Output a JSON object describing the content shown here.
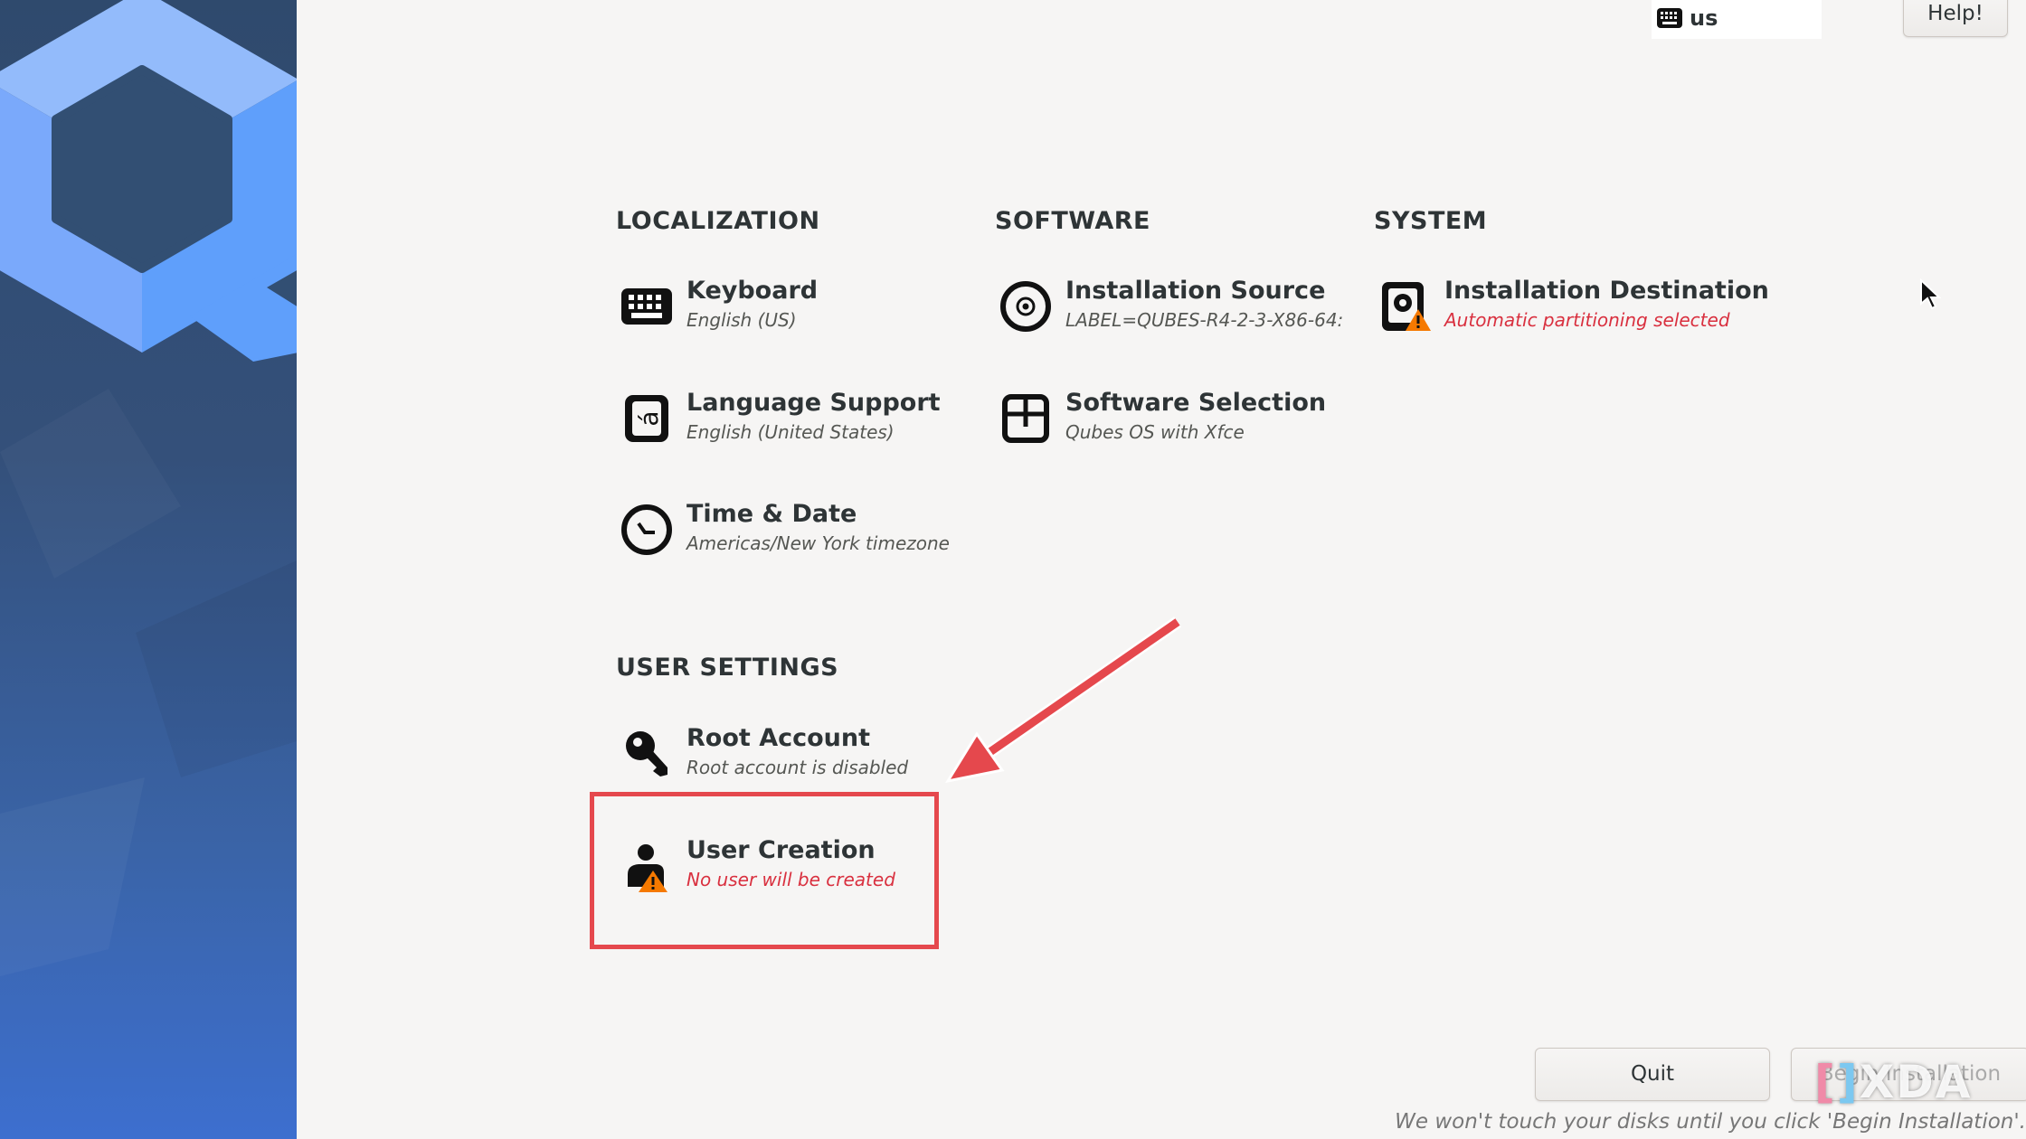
{
  "colors": {
    "accent_warning": "#d9303f",
    "annotation": "#e5484d",
    "sidebar_blue": "#3d6fcf"
  },
  "topbar": {
    "keyboard_layout": "us",
    "keyboard_icon": "keyboard-icon",
    "help_label": "Help!"
  },
  "sections": {
    "localization": "LOCALIZATION",
    "software": "SOFTWARE",
    "system": "SYSTEM",
    "user_settings": "USER SETTINGS"
  },
  "spokes": {
    "keyboard": {
      "title": "Keyboard",
      "status": "English (US)",
      "icon": "keyboard-icon"
    },
    "language": {
      "title": "Language Support",
      "status": "English (United States)",
      "icon": "language-icon"
    },
    "time": {
      "title": "Time & Date",
      "status": "Americas/New York timezone",
      "icon": "clock-icon"
    },
    "source": {
      "title": "Installation Source",
      "status": "LABEL=QUBES-R4-2-3-X86-64:",
      "icon": "disc-icon"
    },
    "software": {
      "title": "Software Selection",
      "status": "Qubes OS with Xfce",
      "icon": "package-icon"
    },
    "destination": {
      "title": "Installation Destination",
      "status": "Automatic partitioning selected",
      "icon": "harddisk-warning-icon",
      "warning": true
    },
    "root": {
      "title": "Root Account",
      "status": "Root account is disabled",
      "icon": "key-icon"
    },
    "user": {
      "title": "User Creation",
      "status": "No user will be created",
      "icon": "user-warning-icon",
      "warning": true
    }
  },
  "actions": {
    "quit_label": "Quit",
    "begin_label": "Begin Installation"
  },
  "footer": {
    "note": "We won't touch your disks until you click 'Begin Installation'."
  },
  "watermark": "XDA"
}
